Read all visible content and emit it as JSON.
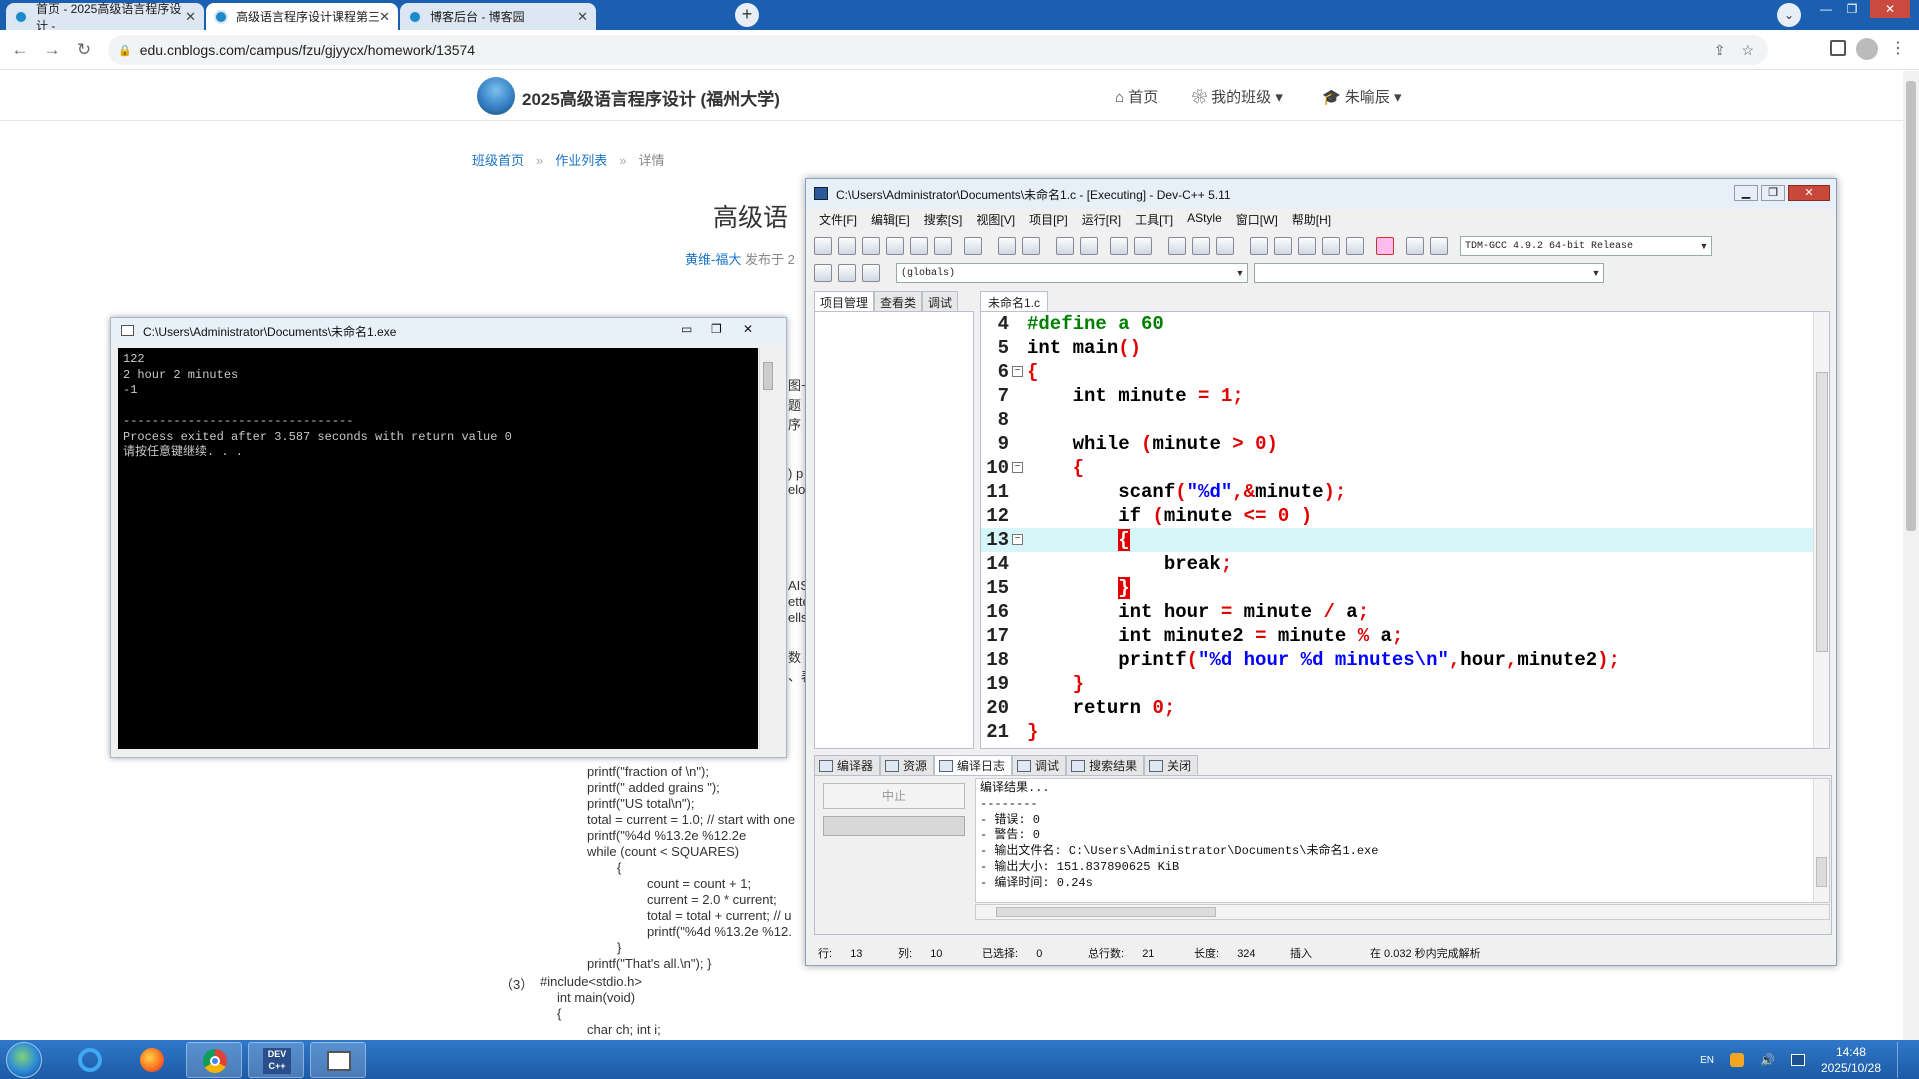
{
  "browser": {
    "tabs": [
      {
        "title": "首页 - 2025高级语言程序设计 -"
      },
      {
        "title": "高级语言程序设计课程第三次作..."
      },
      {
        "title": "博客后台 - 博客园"
      }
    ],
    "url": "edu.cnblogs.com/campus/fzu/gjyycx/homework/13574"
  },
  "site": {
    "title": "2025高级语言程序设计 (福州大学)",
    "nav": [
      "首页",
      "我的班级",
      "朱喻辰"
    ],
    "breadcrumb": [
      "班级首页",
      "作业列表",
      "详情"
    ],
    "heading": "高级语",
    "author": "黄维-福大",
    "published": "发布于 2",
    "left_fragments": [
      "图~",
      "题",
      "序",
      ") p",
      "elo",
      "AIS",
      "ette",
      "ells",
      "数",
      "、表"
    ],
    "code": [
      "printf(\"fraction of \\n\");",
      "printf(\" added grains \");",
      "printf(\"US total\\n\");",
      "total = current = 1.0; // start with one",
      "printf(\"%4d %13.2e %12.2e",
      "while (count < SQUARES)",
      "{",
      "count = count + 1;",
      "current = 2.0 * current;",
      "total = total + current; // u",
      "printf(\"%4d %13.2e %12.",
      "}",
      "printf(\"That's all.\\n\"); }",
      "（3）",
      "#include<stdio.h>",
      "int main(void)",
      "{",
      "char ch; int i;"
    ]
  },
  "console": {
    "title": "C:\\Users\\Administrator\\Documents\\未命名1.exe",
    "lines": [
      "122",
      "2 hour 2 minutes",
      "-1",
      "",
      "--------------------------------",
      "Process exited after 3.587 seconds with return value 0",
      "请按任意键继续. . ."
    ]
  },
  "devcpp": {
    "title": "C:\\Users\\Administrator\\Documents\\未命名1.c - [Executing] - Dev-C++ 5.11",
    "menu": [
      "文件[F]",
      "编辑[E]",
      "搜索[S]",
      "视图[V]",
      "项目[P]",
      "运行[R]",
      "工具[T]",
      "AStyle",
      "窗口[W]",
      "帮助[H]"
    ],
    "compiler": "TDM-GCC 4.9.2 64-bit Release",
    "scope": "(globals)",
    "scope2": "",
    "left_tabs": [
      "项目管理",
      "查看类",
      "调试"
    ],
    "file_tab": "未命名1.c",
    "code_lines": [
      {
        "n": "4"
      },
      {
        "n": "5"
      },
      {
        "n": "6"
      },
      {
        "n": "7"
      },
      {
        "n": "8"
      },
      {
        "n": "9"
      },
      {
        "n": "10"
      },
      {
        "n": "11"
      },
      {
        "n": "12"
      },
      {
        "n": "13"
      },
      {
        "n": "14"
      },
      {
        "n": "15"
      },
      {
        "n": "16"
      },
      {
        "n": "17"
      },
      {
        "n": "18"
      },
      {
        "n": "19"
      },
      {
        "n": "20"
      },
      {
        "n": "21"
      }
    ],
    "bottom_tabs": [
      "编译器",
      "资源",
      "编译日志",
      "调试",
      "搜索结果",
      "关闭"
    ],
    "abort_label": "中止",
    "log": [
      "编译结果...",
      "--------",
      "- 错误: 0",
      "- 警告: 0",
      "- 输出文件名: C:\\Users\\Administrator\\Documents\\未命名1.exe",
      "- 输出大小: 151.837890625 KiB",
      "- 编译时间: 0.24s"
    ],
    "status": {
      "row_label": "行:",
      "row": "13",
      "col_label": "列:",
      "col": "10",
      "sel_label": "已选择:",
      "sel": "0",
      "total_label": "总行数:",
      "total": "21",
      "len_label": "长度:",
      "len": "324",
      "mode": "插入",
      "parse": "在 0.032 秒内完成解析"
    }
  },
  "taskbar": {
    "ime": "EN",
    "time": "14:48",
    "date": "2025/10/28"
  }
}
